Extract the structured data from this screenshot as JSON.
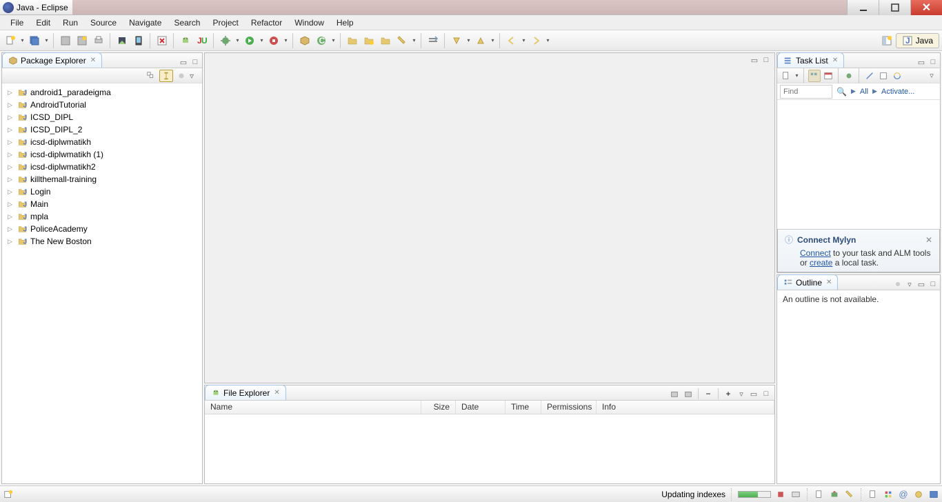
{
  "window": {
    "title": "Java - Eclipse"
  },
  "menu": [
    "File",
    "Edit",
    "Run",
    "Source",
    "Navigate",
    "Search",
    "Project",
    "Refactor",
    "Window",
    "Help"
  ],
  "perspective": {
    "active": "Java"
  },
  "packageExplorer": {
    "title": "Package Explorer",
    "projects": [
      "android1_paradeigma",
      "AndroidTutorial",
      "ICSD_DIPL",
      "ICSD_DIPL_2",
      "icsd-diplwmatikh",
      "icsd-diplwmatikh (1)",
      "icsd-diplwmatikh2",
      "killthemall-training",
      "Login",
      "Main",
      "mpla",
      "PoliceAcademy",
      "The New Boston"
    ]
  },
  "fileExplorer": {
    "title": "File Explorer",
    "columns": [
      "Name",
      "Size",
      "Date",
      "Time",
      "Permissions",
      "Info"
    ]
  },
  "taskList": {
    "title": "Task List",
    "findPlaceholder": "Find",
    "linkAll": "All",
    "linkActivate": "Activate..."
  },
  "mylyn": {
    "title": "Connect Mylyn",
    "connect": "Connect",
    "connectSuffix": " to your task and ALM tools or ",
    "create": "create",
    "createSuffix": " a local task."
  },
  "outline": {
    "title": "Outline",
    "empty": "An outline is not available."
  },
  "status": {
    "operation": "Updating indexes"
  }
}
